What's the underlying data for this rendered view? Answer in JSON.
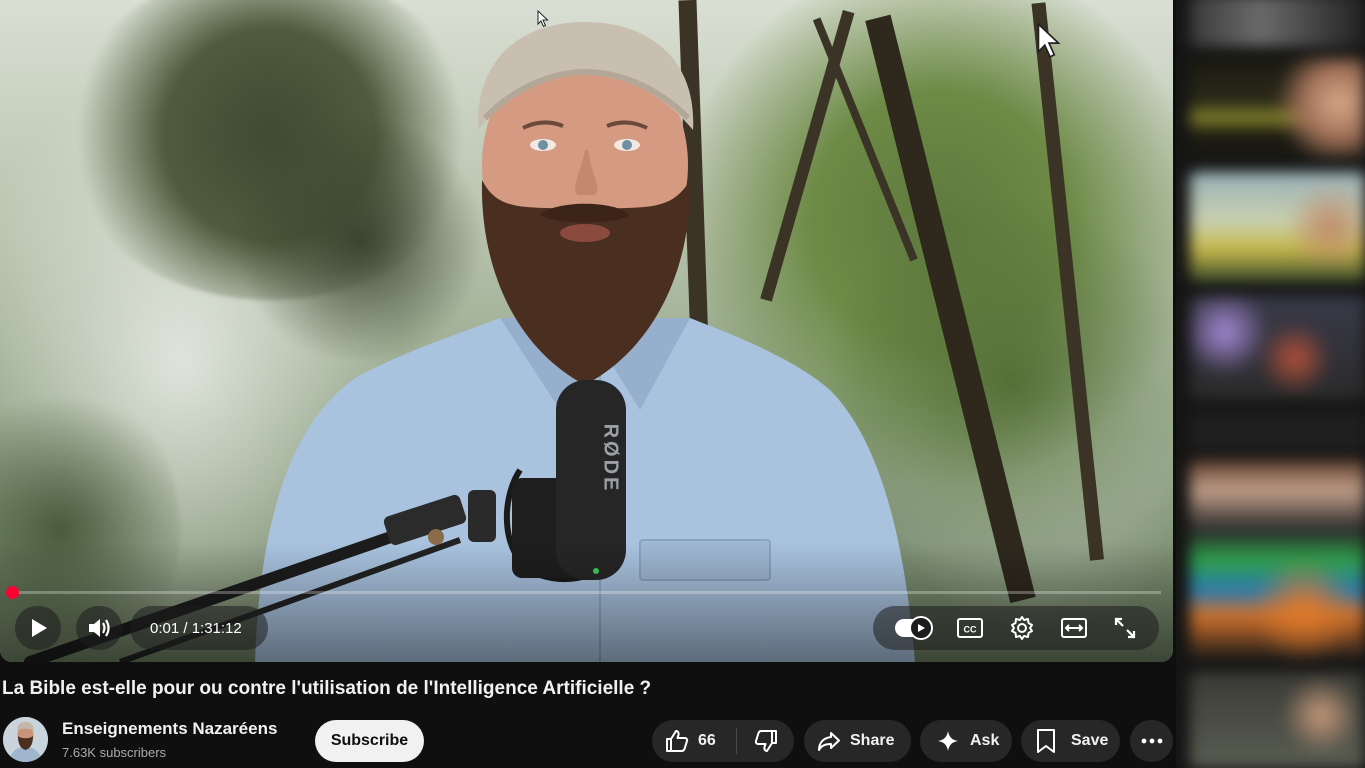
{
  "player": {
    "current_time": "0:01",
    "duration": "1:31:12",
    "time_display": "0:01 / 1:31:12",
    "progress_fraction": 0.0002,
    "mic_brand": "RØDE",
    "accent_color": "#ff0033",
    "icons": {
      "play": "play-icon",
      "volume": "volume-icon",
      "autoplay": "autoplay-toggle-icon",
      "captions": "cc-icon",
      "settings": "gear-icon",
      "theater": "theater-mode-icon",
      "fullscreen": "fullscreen-icon"
    }
  },
  "video": {
    "title": "La Bible est-elle pour ou contre l'utilisation de l'Intelligence Artificielle ?"
  },
  "channel": {
    "name": "Enseignements Nazaréens",
    "subscribers": "7.63K subscribers",
    "subscribe_label": "Subscribe"
  },
  "actions": {
    "like_count": "66",
    "share_label": "Share",
    "ask_label": "Ask",
    "save_label": "Save",
    "icons": {
      "like": "thumbs-up-icon",
      "dislike": "thumbs-down-icon",
      "share": "share-arrow-icon",
      "ask": "sparkle-icon",
      "save": "bookmark-icon",
      "more": "more-horizontal-icon"
    }
  }
}
